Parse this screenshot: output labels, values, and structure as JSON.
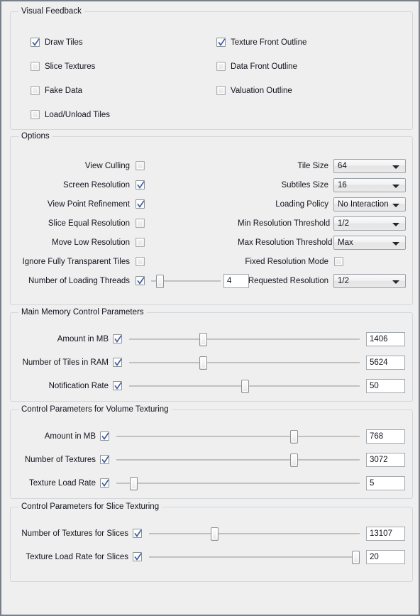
{
  "groups": {
    "visual_feedback": {
      "title": "Visual Feedback",
      "checkboxes_left": [
        {
          "label": "Draw Tiles",
          "checked": true
        },
        {
          "label": "Slice Textures",
          "checked": false
        },
        {
          "label": "Fake Data",
          "checked": false
        },
        {
          "label": "Load/Unload Tiles",
          "checked": false
        }
      ],
      "checkboxes_right": [
        {
          "label": "Texture Front Outline",
          "checked": true
        },
        {
          "label": "Data Front Outline",
          "checked": false
        },
        {
          "label": "Valuation Outline",
          "checked": false
        }
      ]
    },
    "options": {
      "title": "Options",
      "left_rows": [
        {
          "label": "View Culling",
          "checked": false
        },
        {
          "label": "Screen Resolution",
          "checked": true
        },
        {
          "label": "View Point Refinement",
          "checked": true
        },
        {
          "label": "Slice Equal Resolution",
          "checked": false
        },
        {
          "label": "Move Low Resolution",
          "checked": false
        },
        {
          "label": "Ignore Fully Transparent Tiles",
          "checked": false
        },
        {
          "label": "Number of Loading Threads",
          "checked": true,
          "slider": 12,
          "value": "4"
        }
      ],
      "right_rows": [
        {
          "label": "Tile Size",
          "type": "combo",
          "value": "64"
        },
        {
          "label": "Subtiles Size",
          "type": "combo",
          "value": "16"
        },
        {
          "label": "Loading Policy",
          "type": "combo",
          "value": "No Interaction"
        },
        {
          "label": "Min Resolution Threshold",
          "type": "combo",
          "value": "1/2"
        },
        {
          "label": "Max Resolution Threshold",
          "type": "combo",
          "value": "Max"
        },
        {
          "label": "Fixed Resolution Mode",
          "type": "checkbox",
          "checked": false
        },
        {
          "label": "Requested Resolution",
          "type": "combo",
          "value": "1/2"
        }
      ]
    },
    "main_memory": {
      "title": "Main Memory Control Parameters",
      "rows": [
        {
          "label": "Amount in MB",
          "checked": true,
          "slider": 32,
          "value": "1406"
        },
        {
          "label": "Number of Tiles in RAM",
          "checked": true,
          "slider": 32,
          "value": "5624"
        },
        {
          "label": "Notification Rate",
          "checked": true,
          "slider": 50,
          "value": "50"
        }
      ]
    },
    "volume_texturing": {
      "title": "Control Parameters for Volume Texturing",
      "rows": [
        {
          "label": "Amount in MB",
          "checked": true,
          "slider": 73,
          "value": "768"
        },
        {
          "label": "Number of Textures",
          "checked": true,
          "slider": 73,
          "value": "3072"
        },
        {
          "label": "Texture Load Rate",
          "checked": true,
          "slider": 7,
          "value": "5"
        }
      ]
    },
    "slice_texturing": {
      "title": "Control Parameters for Slice Texturing",
      "rows": [
        {
          "label": "Number of Textures for Slices",
          "checked": true,
          "slider": 31,
          "value": "13107"
        },
        {
          "label": "Texture Load Rate for Slices",
          "checked": true,
          "slider": 98,
          "value": "20"
        }
      ]
    }
  },
  "colors": {
    "window_bg": "#efefef",
    "window_border": "#7a8089",
    "group_border": "#d3d7da",
    "text": "#13131f",
    "check_mark": "#39599e"
  }
}
